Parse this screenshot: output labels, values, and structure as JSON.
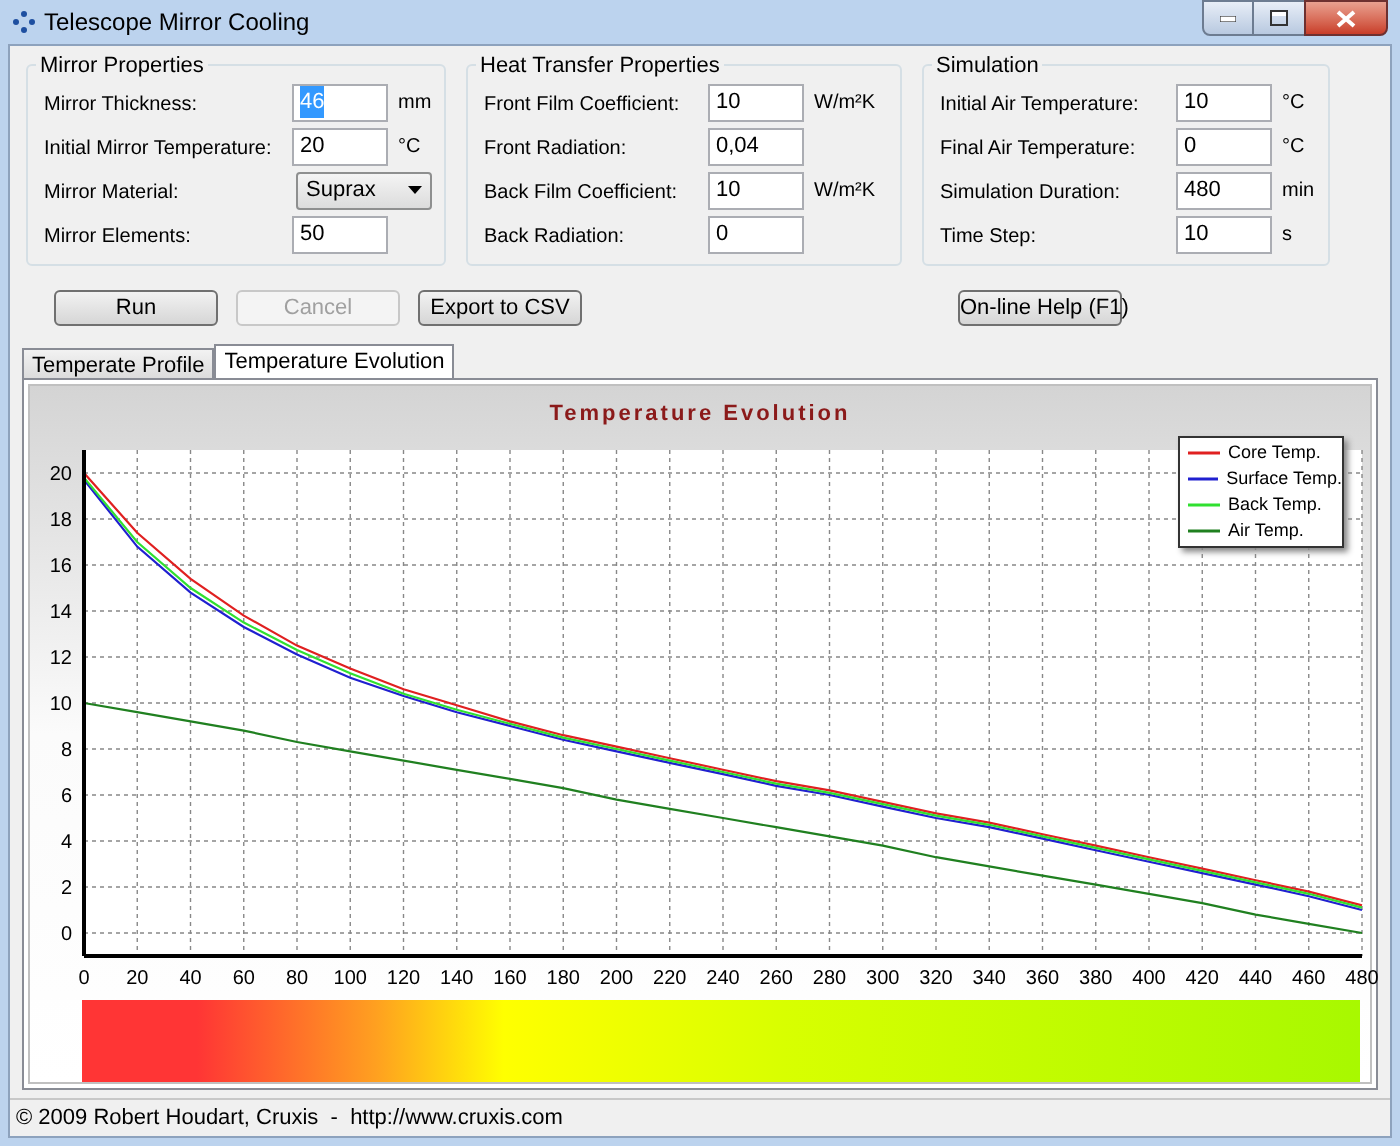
{
  "window": {
    "title": "Telescope Mirror Cooling"
  },
  "groups": [
    {
      "title": "Mirror Properties",
      "fields": [
        {
          "label": "Mirror Thickness:",
          "kind": "text",
          "value": "46",
          "unit": "mm",
          "highlighted": true
        },
        {
          "label": "Initial Mirror Temperature:",
          "kind": "text",
          "value": "20",
          "unit": "°C",
          "highlighted": false
        },
        {
          "label": "Mirror Material:",
          "kind": "select",
          "value": "Suprax",
          "highlighted": false
        },
        {
          "label": "Mirror Elements:",
          "kind": "text",
          "value": "50",
          "highlighted": false
        }
      ]
    },
    {
      "title": "Heat Transfer Properties",
      "fields": [
        {
          "label": "Front Film Coefficient:",
          "kind": "text",
          "value": "10",
          "unit": "W/m²K",
          "highlighted": false
        },
        {
          "label": "Front Radiation:",
          "kind": "text",
          "value": "0,04",
          "highlighted": false
        },
        {
          "label": "Back Film Coefficient:",
          "kind": "text",
          "value": "10",
          "unit": "W/m²K",
          "highlighted": false
        },
        {
          "label": "Back Radiation:",
          "kind": "text",
          "value": "0",
          "highlighted": false
        }
      ]
    },
    {
      "title": "Simulation",
      "fields": [
        {
          "label": "Initial Air Temperature:",
          "kind": "text",
          "value": "10",
          "unit": "°C",
          "highlighted": false
        },
        {
          "label": "Final Air Temperature:",
          "kind": "text",
          "value": "0",
          "unit": "°C",
          "highlighted": false
        },
        {
          "label": "Simulation Duration:",
          "kind": "text",
          "value": "480",
          "unit": "min",
          "highlighted": false
        },
        {
          "label": "Time Step:",
          "kind": "text",
          "value": "10",
          "unit": "s",
          "highlighted": false
        }
      ]
    }
  ],
  "buttons": [
    {
      "label": "Run",
      "disabled": false
    },
    {
      "label": "Cancel",
      "disabled": true
    },
    {
      "label": "Export to CSV",
      "disabled": false
    }
  ],
  "help_button": {
    "label": "On-line Help (F1)"
  },
  "tabs": [
    {
      "label": "Temperate Profile",
      "selected": false
    },
    {
      "label": "Temperature Evolution",
      "selected": true
    }
  ],
  "chart_data": {
    "type": "line",
    "title": "Temperature Evolution",
    "x": [
      0,
      20,
      40,
      60,
      80,
      100,
      120,
      140,
      160,
      180,
      200,
      220,
      240,
      260,
      280,
      300,
      320,
      340,
      360,
      380,
      400,
      420,
      440,
      460,
      480
    ],
    "series": [
      {
        "name": "Core Temp.",
        "color": "#e02020",
        "values": [
          20,
          17.4,
          15.4,
          13.8,
          12.5,
          11.5,
          10.6,
          9.9,
          9.2,
          8.6,
          8.1,
          7.6,
          7.1,
          6.6,
          6.2,
          5.7,
          5.2,
          4.8,
          4.3,
          3.8,
          3.3,
          2.8,
          2.3,
          1.8,
          1.2
        ]
      },
      {
        "name": "Surface Temp.",
        "color": "#2020d0",
        "values": [
          19.7,
          16.8,
          14.8,
          13.3,
          12.1,
          11.1,
          10.3,
          9.6,
          9.0,
          8.4,
          7.9,
          7.4,
          6.9,
          6.4,
          6.0,
          5.5,
          5.0,
          4.6,
          4.1,
          3.6,
          3.1,
          2.6,
          2.1,
          1.6,
          1.0
        ]
      },
      {
        "name": "Back Temp.",
        "color": "#30e030",
        "values": [
          19.8,
          17.0,
          15.0,
          13.5,
          12.3,
          11.3,
          10.4,
          9.7,
          9.1,
          8.5,
          8.0,
          7.5,
          7.0,
          6.5,
          6.1,
          5.6,
          5.1,
          4.7,
          4.2,
          3.7,
          3.2,
          2.7,
          2.2,
          1.7,
          1.1
        ]
      },
      {
        "name": "Air Temp.",
        "color": "#208020",
        "values": [
          10,
          9.6,
          9.2,
          8.8,
          8.3,
          7.9,
          7.5,
          7.1,
          6.7,
          6.3,
          5.8,
          5.4,
          5,
          4.6,
          4.2,
          3.8,
          3.3,
          2.9,
          2.5,
          2.1,
          1.7,
          1.3,
          0.8,
          0.4,
          0
        ]
      }
    ],
    "xlim": [
      0,
      480
    ],
    "ylim": [
      -1,
      21
    ],
    "grid": true,
    "legend": true,
    "xticks": [
      0,
      20,
      40,
      60,
      80,
      100,
      120,
      140,
      160,
      180,
      200,
      220,
      240,
      260,
      280,
      300,
      320,
      340,
      360,
      380,
      400,
      420,
      440,
      460,
      480
    ],
    "yticks": [
      0,
      2,
      4,
      6,
      8,
      10,
      12,
      14,
      16,
      18,
      20
    ]
  },
  "status_bar": {
    "text": "© 2009 Robert Houdart, Cruxis  -  http://www.cruxis.com"
  }
}
